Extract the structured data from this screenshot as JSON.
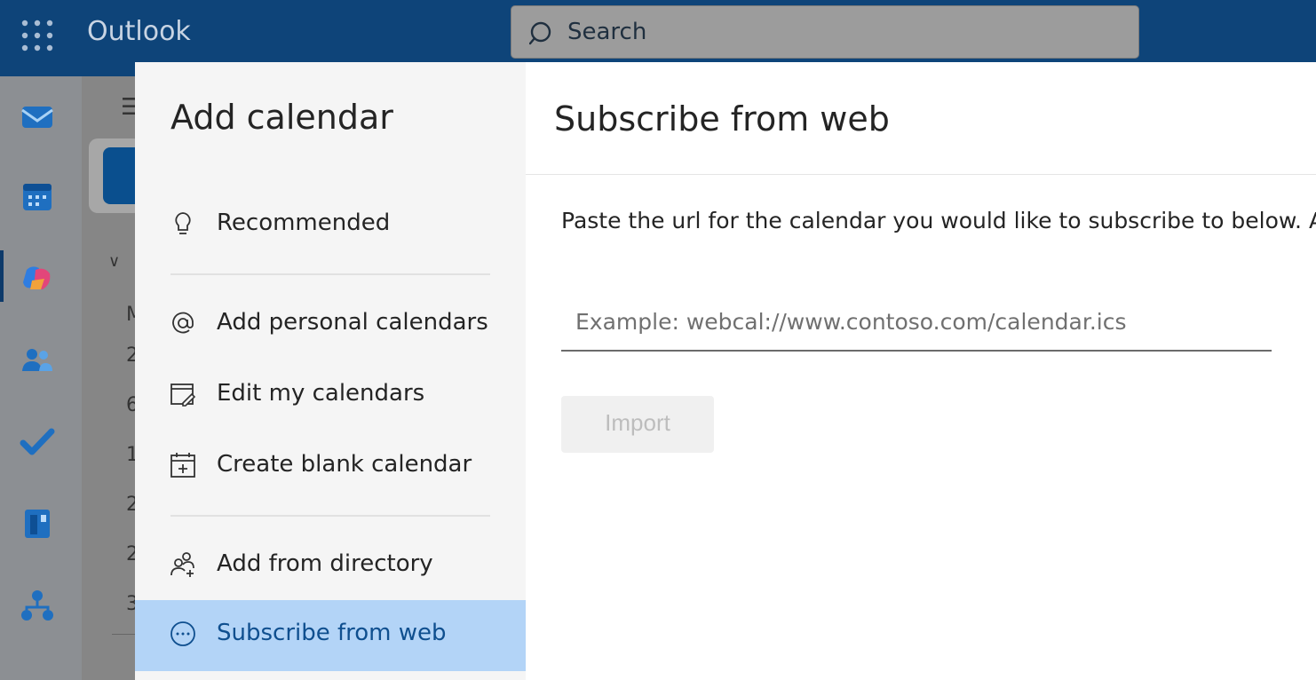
{
  "topbar": {
    "app_name": "Outlook",
    "search_placeholder": "Search"
  },
  "rail": {
    "icons": [
      "mail-icon",
      "calendar-icon",
      "copilot-icon",
      "people-icon",
      "todo-icon",
      "bookings-icon",
      "org-explorer-icon"
    ],
    "active": "calendar-icon"
  },
  "background_partial": [
    "M",
    "2",
    "6",
    "1",
    "2",
    "2",
    "3"
  ],
  "dialog": {
    "title": "Add calendar",
    "nav": [
      {
        "label": "Recommended",
        "icon": "lightbulb-icon"
      },
      {
        "label": "Add personal calendars",
        "icon": "at-icon"
      },
      {
        "label": "Edit my calendars",
        "icon": "edit-calendar-icon"
      },
      {
        "label": "Create blank calendar",
        "icon": "add-calendar-icon"
      },
      {
        "label": "Add from directory",
        "icon": "people-add-icon"
      },
      {
        "label": "Subscribe from web",
        "icon": "web-icon",
        "active": true
      }
    ],
    "pane": {
      "title": "Subscribe from web",
      "instructions": "Paste the url for the calendar you would like to subscribe to below. Ar",
      "url_placeholder": "Example: webcal://www.contoso.com/calendar.ics",
      "url_value": "",
      "import_label": "Import",
      "import_enabled": false
    }
  },
  "colors": {
    "topbar": "#0e4479",
    "active_nav": "#b3d4f7",
    "active_text": "#0f4f8f"
  }
}
